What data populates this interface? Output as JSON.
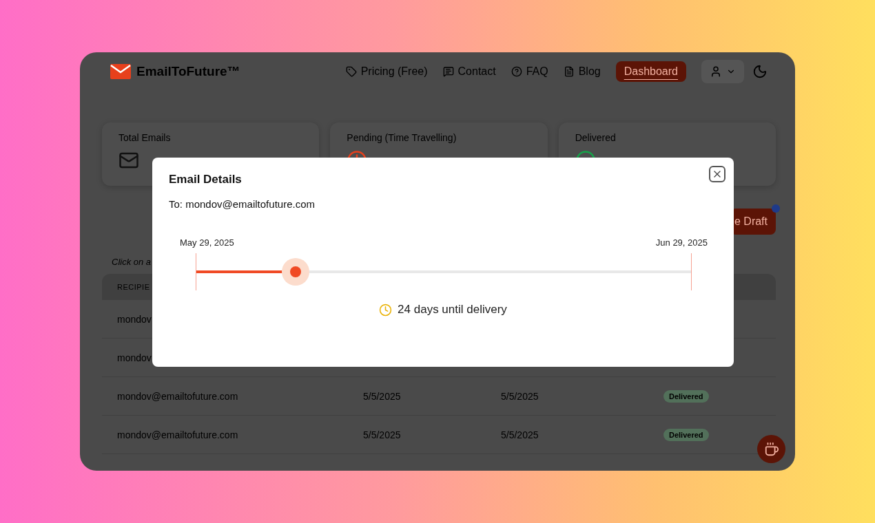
{
  "header": {
    "logo": "EmailToFuture™",
    "nav": [
      {
        "label": "Pricing (Free)",
        "selected": false
      },
      {
        "label": "Contact",
        "selected": false
      },
      {
        "label": "FAQ",
        "selected": false
      },
      {
        "label": "Blog",
        "selected": false
      },
      {
        "label": "Dashboard",
        "selected": true
      }
    ]
  },
  "stats": [
    {
      "label": "Total Emails"
    },
    {
      "label": "Pending (Time Travelling)"
    },
    {
      "label": "Delivered"
    }
  ],
  "draft_button": {
    "label": "e Draft"
  },
  "hint": "Click on a",
  "table": {
    "columns": [
      "RECIPIE"
    ],
    "rows": [
      {
        "cells": [
          "mondov"
        ]
      },
      {
        "cells": [
          "mondov"
        ]
      },
      {
        "cells": [
          "mondov@emailtofuture.com",
          "5/5/2025",
          "5/5/2025"
        ],
        "status": "Delivered"
      },
      {
        "cells": [
          "mondov@emailtofuture.com",
          "5/5/2025",
          "5/5/2025"
        ],
        "status": "Delivered"
      }
    ]
  },
  "modal": {
    "title": "Email Details",
    "recipient": "To: mondov@emailtofuture.com",
    "start_date": "May 29, 2025",
    "end_date": "Jun 29, 2025",
    "level": 0.2,
    "countdown": "24 days until delivery"
  }
}
